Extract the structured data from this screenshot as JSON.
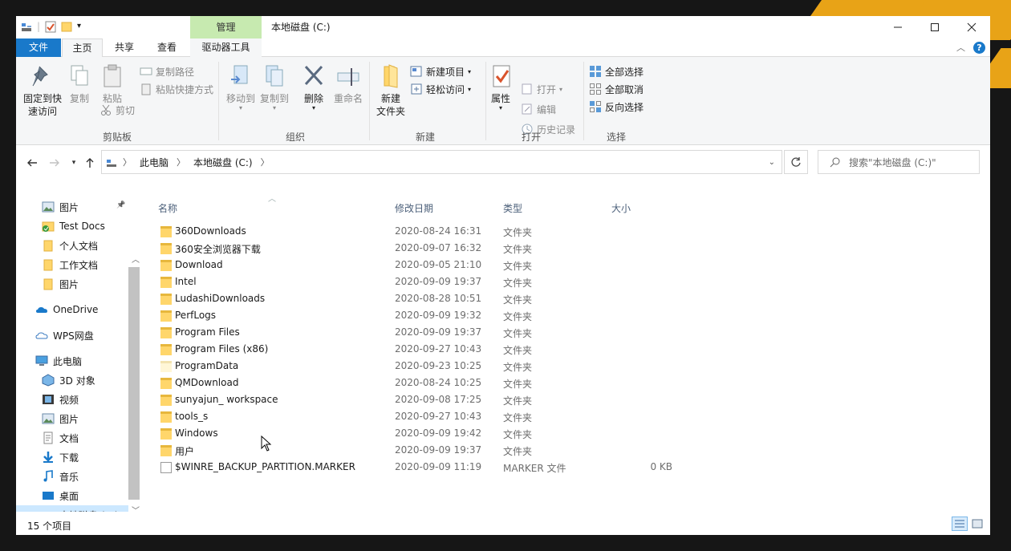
{
  "window": {
    "title": "本地磁盘 (C:)",
    "context_tab_group": "管理"
  },
  "tabs": {
    "file": "文件",
    "home": "主页",
    "share": "共享",
    "view": "查看",
    "drive_tools": "驱动器工具"
  },
  "ribbon": {
    "clipboard": {
      "label": "剪贴板",
      "pin": "固定到快\n速访问",
      "pin_l1": "固定到快",
      "pin_l2": "速访问",
      "copy": "复制",
      "paste": "粘贴",
      "copy_path": "复制路径",
      "paste_shortcut": "粘贴快捷方式",
      "cut": "剪切"
    },
    "organize": {
      "label": "组织",
      "move_to": "移动到",
      "copy_to": "复制到",
      "delete": "删除",
      "rename": "重命名"
    },
    "new": {
      "label": "新建",
      "new_folder_l1": "新建",
      "new_folder_l2": "文件夹",
      "new_item": "新建项目",
      "easy_access": "轻松访问"
    },
    "open": {
      "label": "打开",
      "properties": "属性",
      "open": "打开",
      "edit": "编辑",
      "history": "历史记录"
    },
    "select": {
      "label": "选择",
      "select_all": "全部选择",
      "select_none": "全部取消",
      "invert": "反向选择"
    }
  },
  "address": {
    "crumbs": [
      "此电脑",
      "本地磁盘 (C:)"
    ],
    "search_placeholder": "搜索\"本地磁盘 (C:)\""
  },
  "nav": {
    "items": [
      {
        "label": "图片",
        "icon": "pictures-icon",
        "pinned": true
      },
      {
        "label": "Test Docs",
        "icon": "shared-folder-icon"
      },
      {
        "label": "个人文档",
        "icon": "folder-icon"
      },
      {
        "label": "工作文档",
        "icon": "folder-icon"
      },
      {
        "label": "图片",
        "icon": "folder-icon"
      },
      {
        "label": "OneDrive",
        "icon": "onedrive-cloud-icon"
      },
      {
        "label": "WPS网盘",
        "icon": "wps-cloud-icon"
      },
      {
        "label": "此电脑",
        "icon": "this-pc-icon"
      },
      {
        "label": "3D 对象",
        "icon": "3d-objects-icon"
      },
      {
        "label": "视频",
        "icon": "videos-icon"
      },
      {
        "label": "图片",
        "icon": "pictures-icon"
      },
      {
        "label": "文档",
        "icon": "documents-icon"
      },
      {
        "label": "下载",
        "icon": "downloads-icon"
      },
      {
        "label": "音乐",
        "icon": "music-icon"
      },
      {
        "label": "桌面",
        "icon": "desktop-icon"
      },
      {
        "label": "本地磁盘 (C:)",
        "icon": "drive-icon",
        "selected": true
      }
    ]
  },
  "columns": {
    "name": "名称",
    "modified": "修改日期",
    "type": "类型",
    "size": "大小"
  },
  "files": [
    {
      "name": "360Downloads",
      "date": "2020-08-24 16:31",
      "type": "文件夹",
      "size": ""
    },
    {
      "name": "360安全浏览器下载",
      "date": "2020-09-07 16:32",
      "type": "文件夹",
      "size": ""
    },
    {
      "name": "Download",
      "date": "2020-09-05 21:10",
      "type": "文件夹",
      "size": ""
    },
    {
      "name": "Intel",
      "date": "2020-09-09 19:37",
      "type": "文件夹",
      "size": ""
    },
    {
      "name": "LudashiDownloads",
      "date": "2020-08-28 10:51",
      "type": "文件夹",
      "size": ""
    },
    {
      "name": "PerfLogs",
      "date": "2020-09-09 19:32",
      "type": "文件夹",
      "size": ""
    },
    {
      "name": "Program Files",
      "date": "2020-09-09 19:37",
      "type": "文件夹",
      "size": ""
    },
    {
      "name": "Program Files (x86)",
      "date": "2020-09-27 10:43",
      "type": "文件夹",
      "size": ""
    },
    {
      "name": "ProgramData",
      "date": "2020-09-23 10:25",
      "type": "文件夹",
      "size": "",
      "hidden": true
    },
    {
      "name": "QMDownload",
      "date": "2020-08-24 10:25",
      "type": "文件夹",
      "size": ""
    },
    {
      "name": "sunyajun_ workspace",
      "date": "2020-09-08 17:25",
      "type": "文件夹",
      "size": ""
    },
    {
      "name": "tools_s",
      "date": "2020-09-27 10:43",
      "type": "文件夹",
      "size": ""
    },
    {
      "name": "Windows",
      "date": "2020-09-09 19:42",
      "type": "文件夹",
      "size": ""
    },
    {
      "name": "用户",
      "date": "2020-09-09 19:37",
      "type": "文件夹",
      "size": ""
    },
    {
      "name": "$WINRE_BACKUP_PARTITION.MARKER",
      "date": "2020-09-09 11:19",
      "type": "MARKER 文件",
      "size": "0 KB",
      "is_file": true
    }
  ],
  "status": {
    "count": "15 个项目"
  },
  "colors": {
    "accent": "#1979ca",
    "context_tab": "#c7eab0",
    "selection": "#cce8ff",
    "folder": "#ffd66b"
  }
}
